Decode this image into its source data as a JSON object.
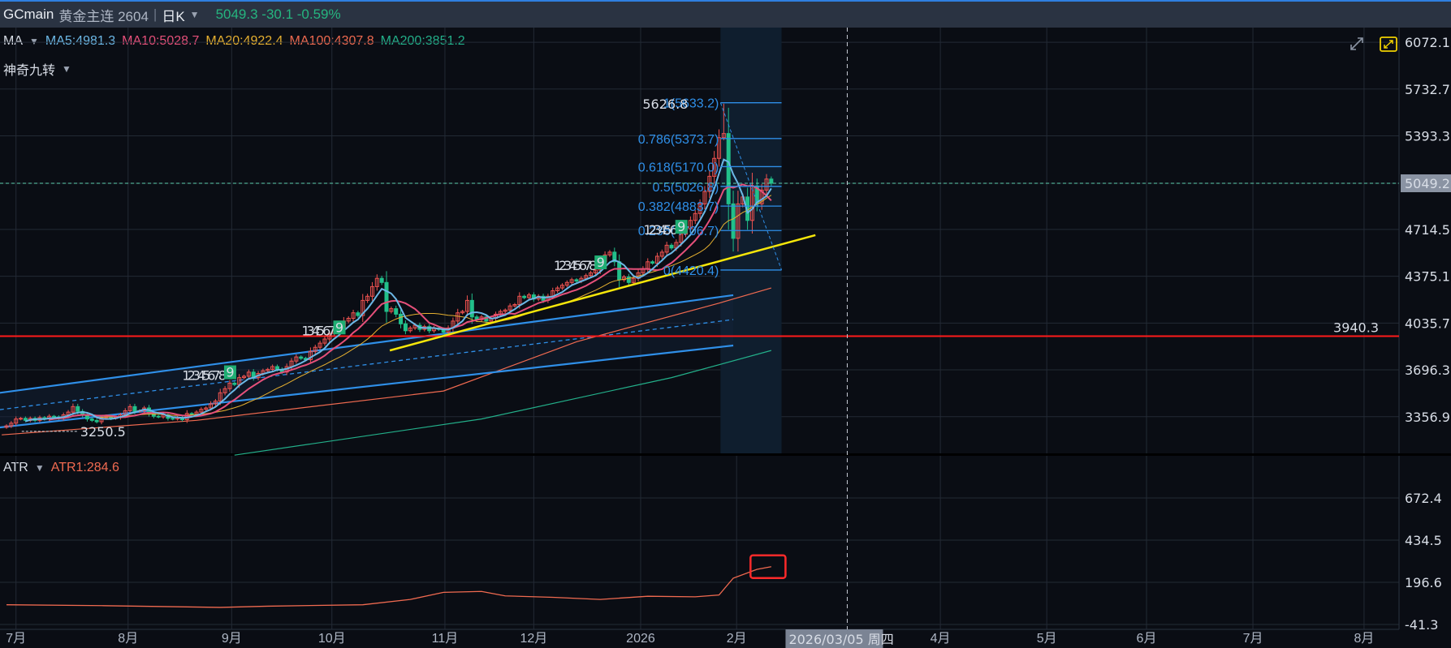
{
  "header": {
    "symbol": "GCmain",
    "name": "黄金主连 2604",
    "separator": "|",
    "period": "日K",
    "quote": "5049.3 -30.1 -0.59%"
  },
  "ma_legend": {
    "label": "MA",
    "items": [
      {
        "text": "MA5:4981.3",
        "color": "#6cb8e6"
      },
      {
        "text": "MA10:5028.7",
        "color": "#e6507a"
      },
      {
        "text": "MA20:4922.4",
        "color": "#e6b030"
      },
      {
        "text": "MA100:4307.8",
        "color": "#f06a50"
      },
      {
        "text": "MA200:3851.2",
        "color": "#23b08a"
      }
    ]
  },
  "td_legend": {
    "label": "神奇九转"
  },
  "atr_legend": {
    "label": "ATR",
    "value": "ATR1:284.6",
    "color": "#f06a50"
  },
  "icons": {
    "expand": "expand-arrows-icon",
    "fullscreen": "fullscreen-icon"
  },
  "chart_data": {
    "type": "candlestick",
    "price_axis": {
      "labels": [
        "6072.1",
        "5732.7",
        "5393.3",
        "5049.2",
        "4714.5",
        "4375.1",
        "4035.7",
        "3696.3",
        "3356.9"
      ],
      "values": [
        6072.1,
        5732.7,
        5393.3,
        5049.2,
        4714.5,
        4375.1,
        4035.7,
        3696.3,
        3356.9
      ]
    },
    "atr_axis": {
      "labels": [
        "672.4",
        "434.5",
        "196.6",
        "-41.3"
      ],
      "values": [
        672.4,
        434.5,
        196.6,
        -41.3
      ]
    },
    "x_ticks": [
      {
        "label": "7月",
        "bar": 2
      },
      {
        "label": "8月",
        "bar": 25.6
      },
      {
        "label": "9月",
        "bar": 47.4
      },
      {
        "label": "10月",
        "bar": 68.5
      },
      {
        "label": "11月",
        "bar": 92.3
      },
      {
        "label": "12月",
        "bar": 111
      },
      {
        "label": "2026",
        "bar": 133.5
      },
      {
        "label": "2月",
        "bar": 153.7
      },
      {
        "label": "4月",
        "bar": 196.6
      },
      {
        "label": "5月",
        "bar": 219
      },
      {
        "label": "6月",
        "bar": 240
      },
      {
        "label": "7月",
        "bar": 262.4
      },
      {
        "label": "8月",
        "bar": 285.8
      }
    ],
    "cursor": {
      "bar": 177,
      "label": "2026/03/05 周四"
    },
    "closes": [
      3290,
      3310,
      3340,
      3345,
      3330,
      3345,
      3330,
      3350,
      3340,
      3360,
      3355,
      3345,
      3370,
      3390,
      3430,
      3395,
      3370,
      3340,
      3330,
      3320,
      3350,
      3360,
      3345,
      3350,
      3370,
      3400,
      3430,
      3395,
      3400,
      3420,
      3380,
      3360,
      3355,
      3370,
      3345,
      3340,
      3350,
      3335,
      3380,
      3375,
      3390,
      3410,
      3420,
      3450,
      3470,
      3530,
      3560,
      3600,
      3590,
      3640,
      3650,
      3680,
      3640,
      3670,
      3690,
      3700,
      3720,
      3700,
      3680,
      3720,
      3760,
      3790,
      3780,
      3770,
      3830,
      3860,
      3890,
      3920,
      3960,
      3980,
      3990,
      4050,
      4070,
      4110,
      4090,
      4200,
      4230,
      4300,
      4360,
      4330,
      4120,
      4140,
      4100,
      4030,
      3980,
      4000,
      4020,
      3990,
      4010,
      3980,
      4000,
      3990,
      3970,
      4000,
      4050,
      4110,
      4120,
      4200,
      4080,
      4060,
      4080,
      4050,
      4070,
      4100,
      4120,
      4130,
      4160,
      4170,
      4230,
      4220,
      4240,
      4210,
      4230,
      4200,
      4230,
      4270,
      4290,
      4310,
      4330,
      4350,
      4340,
      4360,
      4380,
      4400,
      4420,
      4480,
      4530,
      4550,
      4480,
      4350,
      4370,
      4330,
      4360,
      4400,
      4430,
      4480,
      4470,
      4520,
      4550,
      4600,
      4580,
      4620,
      4680,
      4720,
      4780,
      4830,
      4900,
      4990,
      5100,
      5230,
      5380,
      5410,
      4900,
      4650,
      4900,
      4950,
      4780,
      5030,
      4900,
      5000,
      5080,
      5049.3
    ],
    "peak": {
      "bar": 151,
      "value": 5626.8,
      "label": "5626.8"
    },
    "low_mark": {
      "bar": 8,
      "value": 3250.5,
      "label": "3250.5"
    },
    "last_price": {
      "value": 5049.2,
      "label": "5049.2"
    },
    "horizontal_line": {
      "value": 3940.3,
      "label": "3940.3",
      "color": "#ff1a1a"
    },
    "ma100": [
      [
        -1,
        3225
      ],
      [
        40,
        3330
      ],
      [
        92,
        3543
      ],
      [
        120,
        3900
      ],
      [
        150,
        4180
      ],
      [
        161,
        4290
      ]
    ],
    "ma200": [
      [
        48,
        3078
      ],
      [
        100,
        3340
      ],
      [
        140,
        3640
      ],
      [
        161,
        3837
      ]
    ],
    "channel": {
      "upper": [
        [
          -1.4,
          3530
        ],
        [
          153,
          4238
        ]
      ],
      "middle": [
        [
          -1.4,
          3408
        ],
        [
          153,
          4061
        ]
      ],
      "lower": [
        [
          -1.4,
          3279
        ],
        [
          153,
          3873
        ]
      ]
    },
    "trendline": [
      [
        80.7,
        3837
      ],
      [
        170.3,
        4673
      ]
    ],
    "fibonacci": {
      "start_bar": 151,
      "end_bar": 163,
      "levels": [
        {
          "ratio": 1,
          "price": 5633.2,
          "label": "1(5633.2)"
        },
        {
          "ratio": 0.786,
          "price": 5373.7,
          "label": "0.786(5373.7)"
        },
        {
          "ratio": 0.618,
          "price": 5170.0,
          "label": "0.618(5170.0)"
        },
        {
          "ratio": 0.5,
          "price": 5026.8,
          "label": "0.5(5026.8)"
        },
        {
          "ratio": 0.382,
          "price": 4883.7,
          "label": "0.382(4883.7)"
        },
        {
          "ratio": 0.236,
          "price": 4706.7,
          "label": "0.236(4706.7)"
        },
        {
          "ratio": 0,
          "price": 4420.4,
          "label": "0(4420.4)"
        }
      ]
    },
    "td_sequences": [
      {
        "bar": 47,
        "price": 3670,
        "count": "1234567 8",
        "mark": "9"
      },
      {
        "bar": 70,
        "price": 3995,
        "count": "1345 67",
        "mark": "9"
      },
      {
        "bar": 125,
        "price": 4467,
        "count": "12345678",
        "mark": "9"
      },
      {
        "bar": 142,
        "price": 4725,
        "count": "12345 6",
        "mark": "9"
      }
    ],
    "atr": [
      [
        0,
        70
      ],
      [
        20,
        65
      ],
      [
        45,
        55
      ],
      [
        55,
        62
      ],
      [
        75,
        70
      ],
      [
        85,
        100
      ],
      [
        92,
        140
      ],
      [
        100,
        145
      ],
      [
        105,
        120
      ],
      [
        115,
        112
      ],
      [
        125,
        100
      ],
      [
        135,
        118
      ],
      [
        145,
        115
      ],
      [
        150,
        125
      ],
      [
        153,
        220
      ],
      [
        158,
        270
      ],
      [
        161,
        284.6
      ]
    ],
    "atr_highlight": {
      "start_bar": 158,
      "end_bar": 164
    },
    "colors": {
      "up": "#ef5350",
      "down": "#22c08a",
      "channel": "#2f8fe8",
      "trend": "#f5e60a",
      "fib": "#2f8fe8",
      "grid": "#232a35",
      "last": "#5fd0b0"
    }
  }
}
